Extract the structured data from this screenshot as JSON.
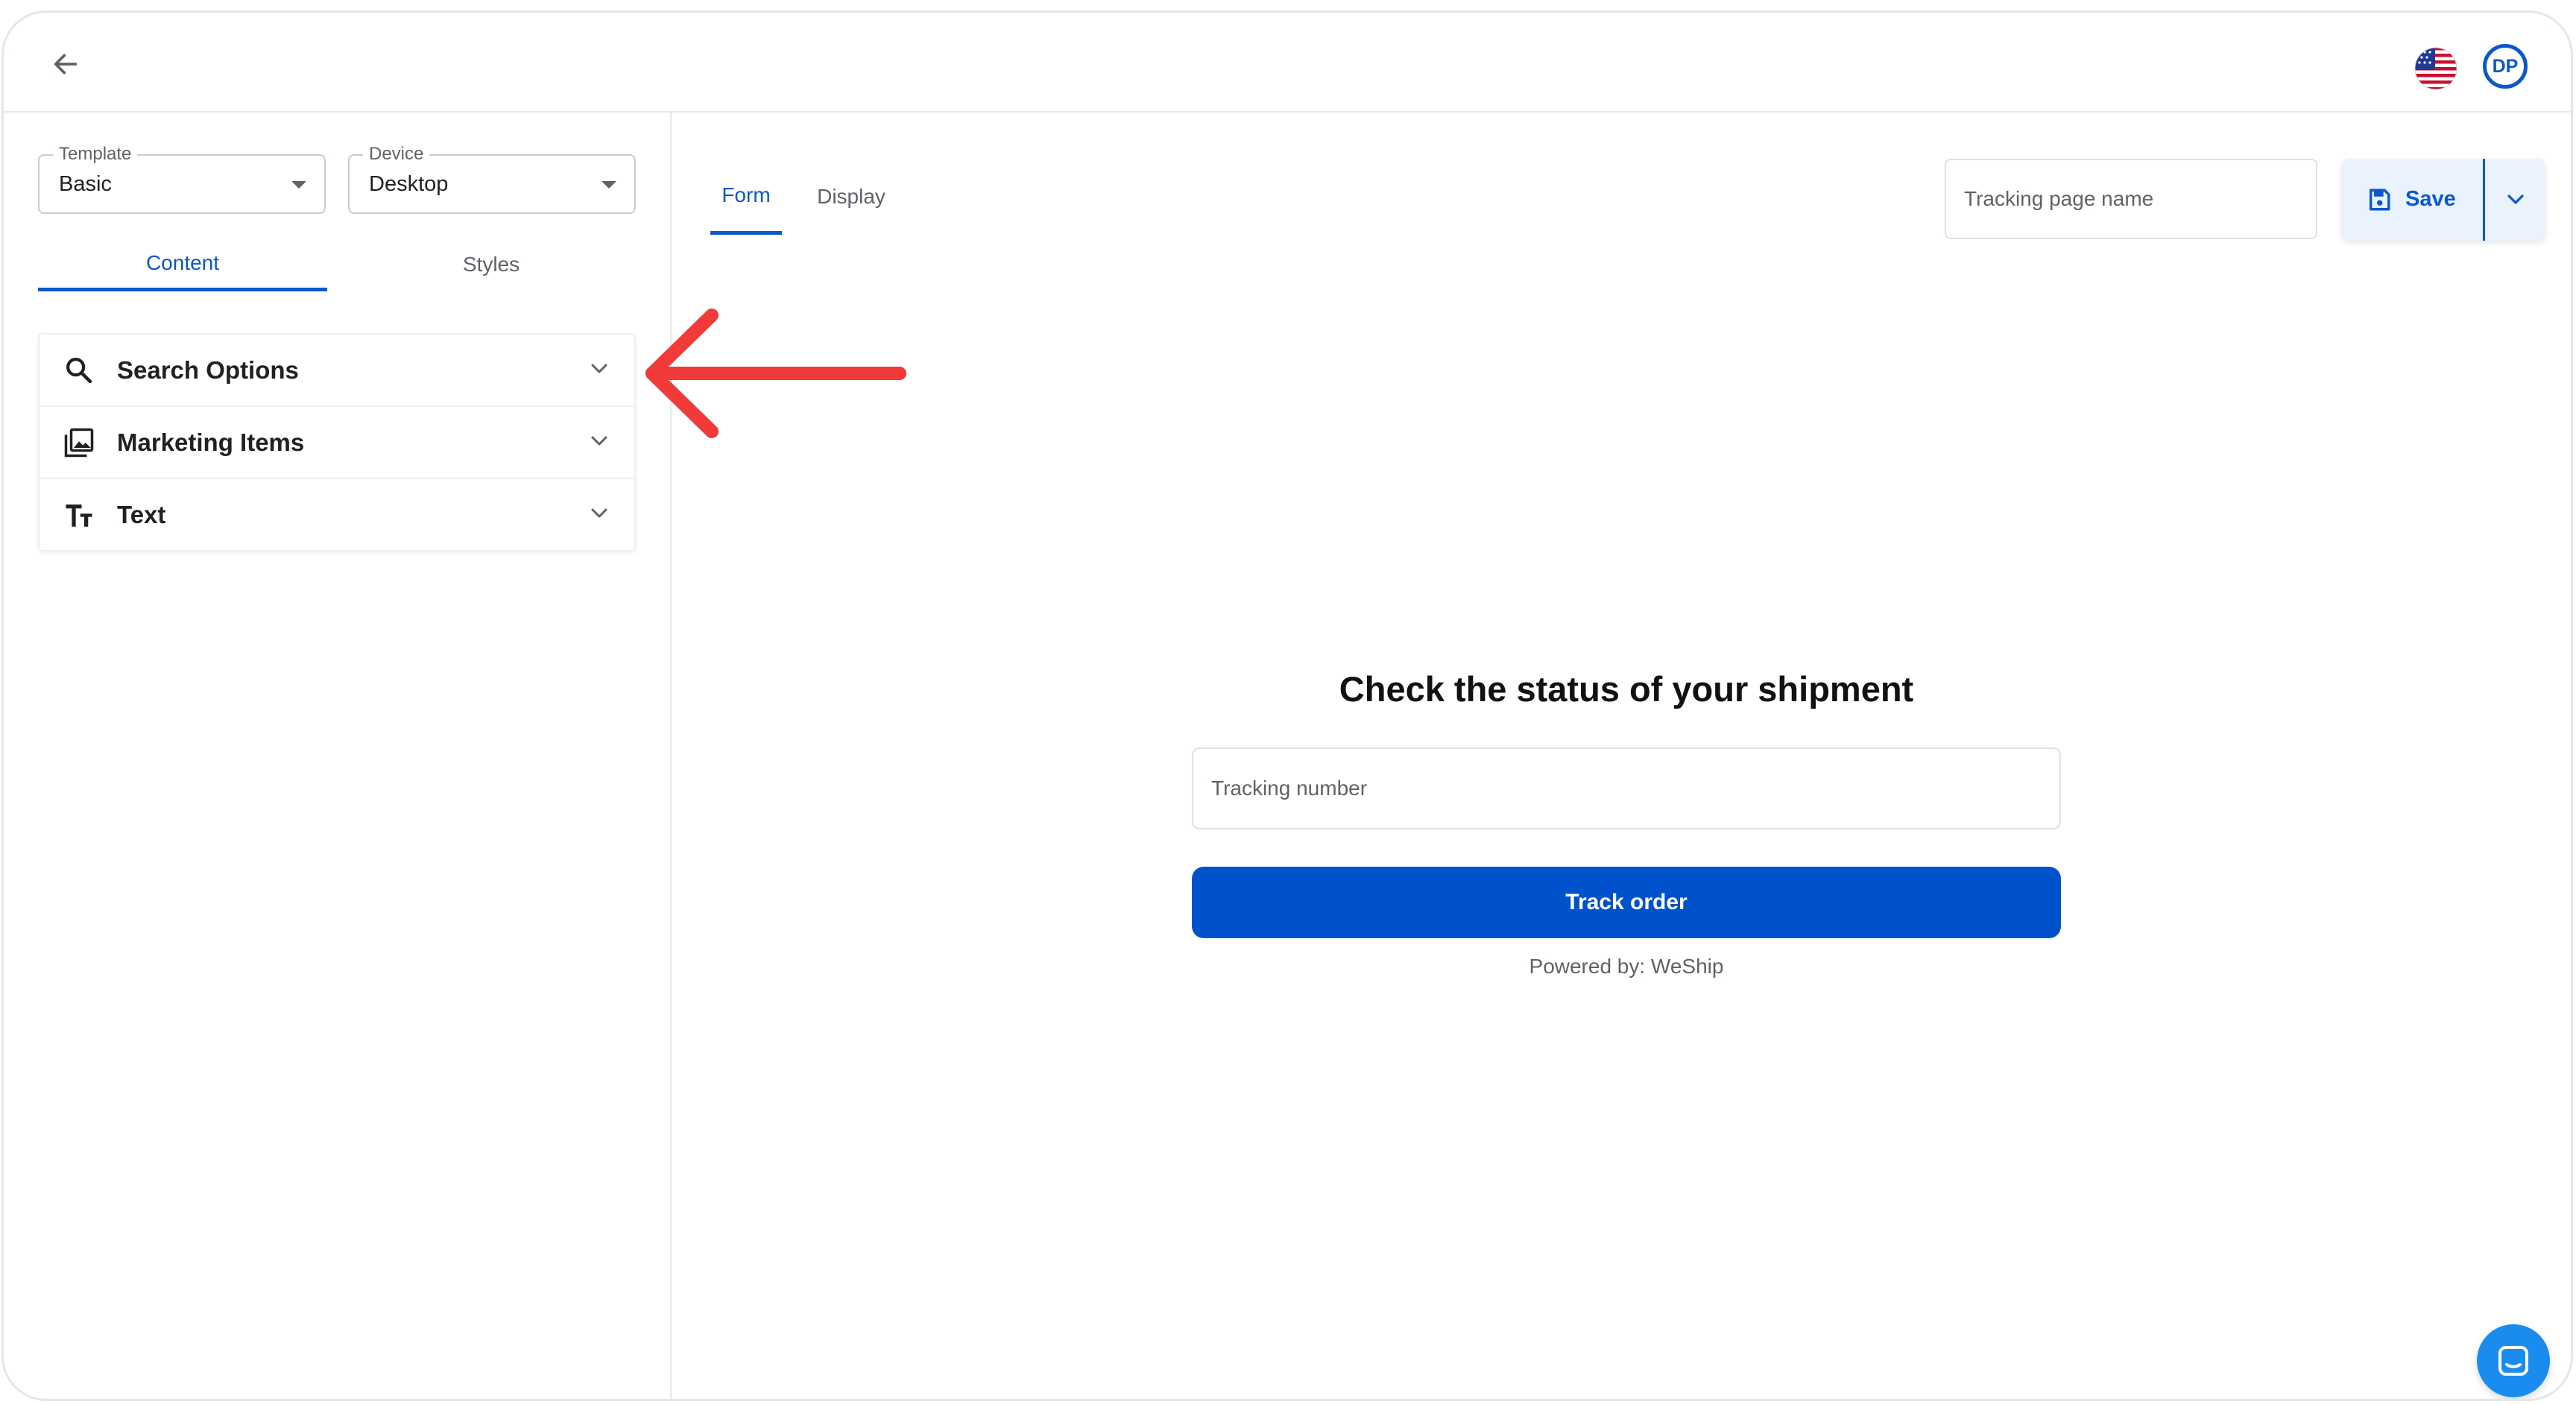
{
  "header": {
    "back_icon": "arrow-left-icon",
    "flag_icon": "us-flag-icon",
    "avatar_initials": "DP"
  },
  "sidebar": {
    "template_select": {
      "label": "Template",
      "value": "Basic"
    },
    "device_select": {
      "label": "Device",
      "value": "Desktop"
    },
    "tabs": [
      {
        "label": "Content",
        "active": true
      },
      {
        "label": "Styles",
        "active": false
      }
    ],
    "sections": [
      {
        "label": "Search Options",
        "icon": "search-icon"
      },
      {
        "label": "Marketing Items",
        "icon": "image-stack-icon"
      },
      {
        "label": "Text",
        "icon": "text-size-icon"
      }
    ]
  },
  "main": {
    "tabs": [
      {
        "label": "Form",
        "active": true
      },
      {
        "label": "Display",
        "active": false
      }
    ],
    "page_name_placeholder": "Tracking page name",
    "save_label": "Save",
    "preview": {
      "heading": "Check the status of your shipment",
      "tracking_placeholder": "Tracking number",
      "track_button": "Track order",
      "powered_by": "Powered by: WeShip"
    }
  },
  "colors": {
    "primary": "#0b57d0",
    "button": "#0052cc",
    "annotation_arrow": "#f23a3a",
    "chat_button": "#1a8cf0"
  }
}
